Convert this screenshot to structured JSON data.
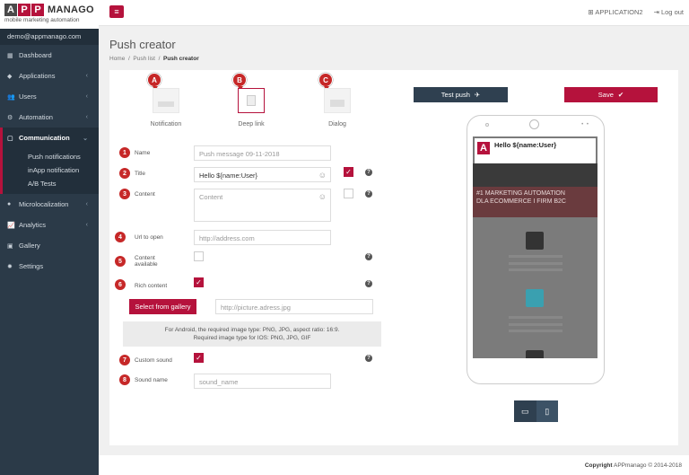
{
  "logo": {
    "letter1": "A",
    "letter2": "P",
    "letter3": "P",
    "word": "MANAGO",
    "tagline": "mobile marketing automation"
  },
  "user": {
    "email": "demo@appmanago.com"
  },
  "nav": [
    {
      "label": "Dashboard",
      "icon": "grid-icon"
    },
    {
      "label": "Applications",
      "icon": "diamond-icon"
    },
    {
      "label": "Users",
      "icon": "users-icon"
    },
    {
      "label": "Automation",
      "icon": "gears-icon"
    },
    {
      "label": "Communication",
      "icon": "comment-icon"
    },
    {
      "label": "Microlocalization",
      "icon": "pin-icon"
    },
    {
      "label": "Analytics",
      "icon": "chart-icon"
    },
    {
      "label": "Gallery",
      "icon": "image-icon"
    },
    {
      "label": "Settings",
      "icon": "gear-icon"
    }
  ],
  "comm_sub": [
    "Push notifications",
    "inApp notification",
    "A/B Tests"
  ],
  "topbar": {
    "app": "APPLICATION2",
    "logout": "Log out"
  },
  "page": {
    "title": "Push creator",
    "crumb_home": "Home",
    "crumb_list": "Push list",
    "crumb_current": "Push creator"
  },
  "types": [
    {
      "marker": "A",
      "label": "Notification"
    },
    {
      "marker": "B",
      "label": "Deep link"
    },
    {
      "marker": "C",
      "label": "Dialog"
    }
  ],
  "fields": {
    "name": {
      "num": "1",
      "label": "Name",
      "value": "Push message 09-11-2018"
    },
    "title": {
      "num": "2",
      "label": "Title",
      "value": "Hello ${name:User}"
    },
    "content": {
      "num": "3",
      "label": "Content",
      "placeholder": "Content"
    },
    "url": {
      "num": "4",
      "label": "Url to open",
      "placeholder": "http://address.com"
    },
    "content_available": {
      "num": "5",
      "label1": "Content",
      "label2": "available"
    },
    "rich": {
      "num": "6",
      "label": "Rich content"
    },
    "gallery_btn": "Select from gallery",
    "picture": {
      "placeholder": "http://picture.adress.jpg"
    },
    "info1": "For Android, the required image type: PNG, JPG, aspect ratio: 16:9.",
    "info2": "Required image type for IOS: PNG, JPG, GIF",
    "sound": {
      "num": "7",
      "label": "Custom sound"
    },
    "sound_name": {
      "num": "8",
      "label": "Sound name",
      "placeholder": "sound_name"
    }
  },
  "actions": {
    "test": "Test push",
    "save": "Save"
  },
  "preview": {
    "notif_title": "Hello ${name:User}",
    "notif_logo": "A",
    "hero1": "#1 MARKETING AUTOMATION",
    "hero2": "DLA ECOMMERCE I FIRM B2C"
  },
  "footer": {
    "copy_bold": "Copyright",
    "copy_rest": "APPmanago © 2014-2018"
  },
  "colors": {
    "brand": "#b5123c",
    "sidebar": "#2b3a48",
    "marker": "#c62828"
  }
}
